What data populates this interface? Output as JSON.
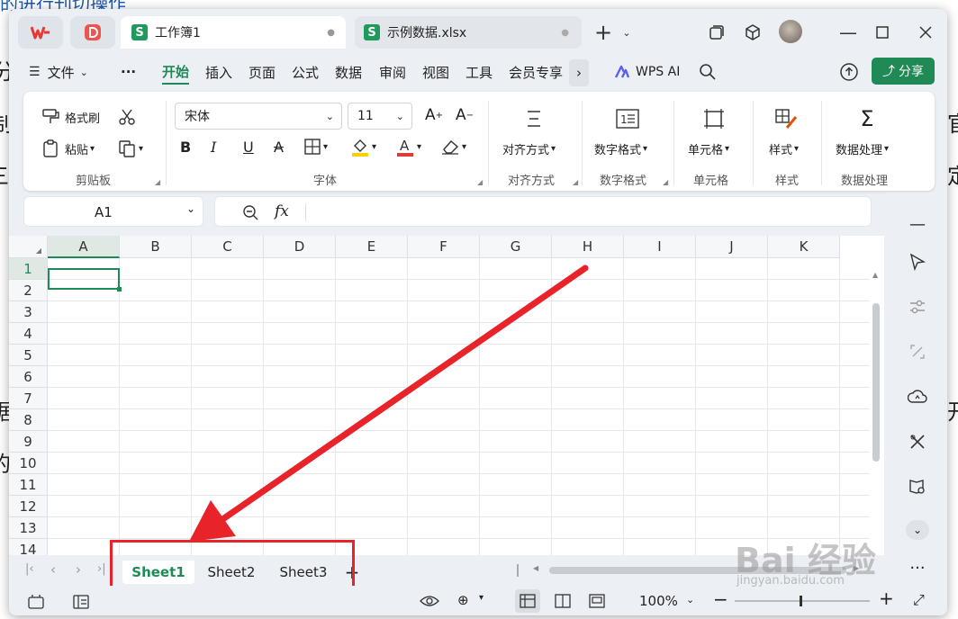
{
  "background": {
    "texts": [
      "的进行刊切操作",
      "分",
      "制",
      "三",
      "据",
      "的",
      "官",
      "定",
      "开"
    ]
  },
  "titlebar": {
    "tabs": [
      {
        "label": "工作簿1"
      },
      {
        "label": "示例数据.xlsx"
      }
    ],
    "icon_letter": "S",
    "new_tab": "+"
  },
  "menu": {
    "file": "文件",
    "items": [
      "开始",
      "插入",
      "页面",
      "公式",
      "数据",
      "审阅",
      "视图",
      "工具",
      "会员专享"
    ],
    "wps_ai": "WPS AI",
    "share": "分享"
  },
  "ribbon": {
    "format_painter": "格式刷",
    "paste": "粘贴",
    "clipboard_group": "剪贴板",
    "font_name": "宋体",
    "font_size": "11",
    "font_group": "字体",
    "align": "对齐方式",
    "align_group": "对齐方式",
    "numfmt": "数字格式",
    "numfmt_group": "数字格式",
    "cell": "单元格",
    "cell_group": "单元格",
    "style": "样式",
    "style_group": "样式",
    "dataproc": "数据处理",
    "dataproc_group": "数据处理"
  },
  "formula": {
    "name_box": "A1",
    "fx": "fx"
  },
  "grid": {
    "columns": [
      "A",
      "B",
      "C",
      "D",
      "E",
      "F",
      "G",
      "H",
      "I",
      "J",
      "K"
    ],
    "rows": [
      "1",
      "2",
      "3",
      "4",
      "5",
      "6",
      "7",
      "8",
      "9",
      "10",
      "11",
      "12",
      "13",
      "14"
    ]
  },
  "sheets": {
    "tabs": [
      "Sheet1",
      "Sheet2",
      "Sheet3"
    ],
    "active": "Sheet1",
    "add": "+"
  },
  "status": {
    "zoom": "100%"
  },
  "watermark": {
    "text": "Bai 经验",
    "sub": "jingyan.baidu.com"
  },
  "colors": {
    "accent": "#1f8a55",
    "arrow": "#e8232a"
  }
}
